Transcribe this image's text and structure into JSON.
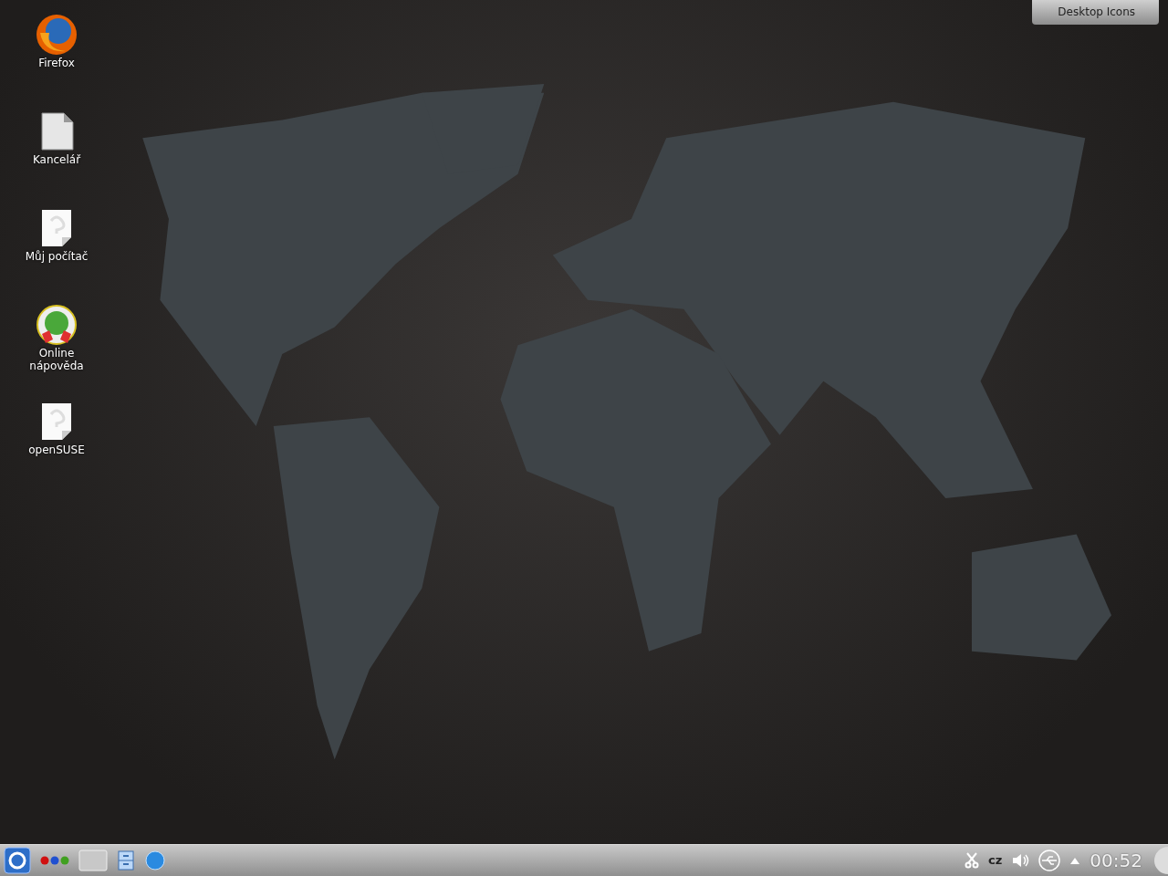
{
  "desktop_icons": [
    {
      "kind": "firefox",
      "label": "Firefox"
    },
    {
      "kind": "office",
      "label": "Kancelář"
    },
    {
      "kind": "unknown",
      "label": "Můj počítač"
    },
    {
      "kind": "help",
      "label": "Online nápověda"
    },
    {
      "kind": "unknown",
      "label": "openSUSE"
    }
  ],
  "toolbox": {
    "label": "Desktop Icons"
  },
  "panel": {
    "launchers": [
      {
        "kind": "menu"
      },
      {
        "kind": "activities"
      },
      {
        "kind": "pager"
      },
      {
        "kind": "files"
      },
      {
        "kind": "network"
      }
    ],
    "tray": {
      "keyboard_layout": "cz",
      "clock": "00:52"
    }
  }
}
